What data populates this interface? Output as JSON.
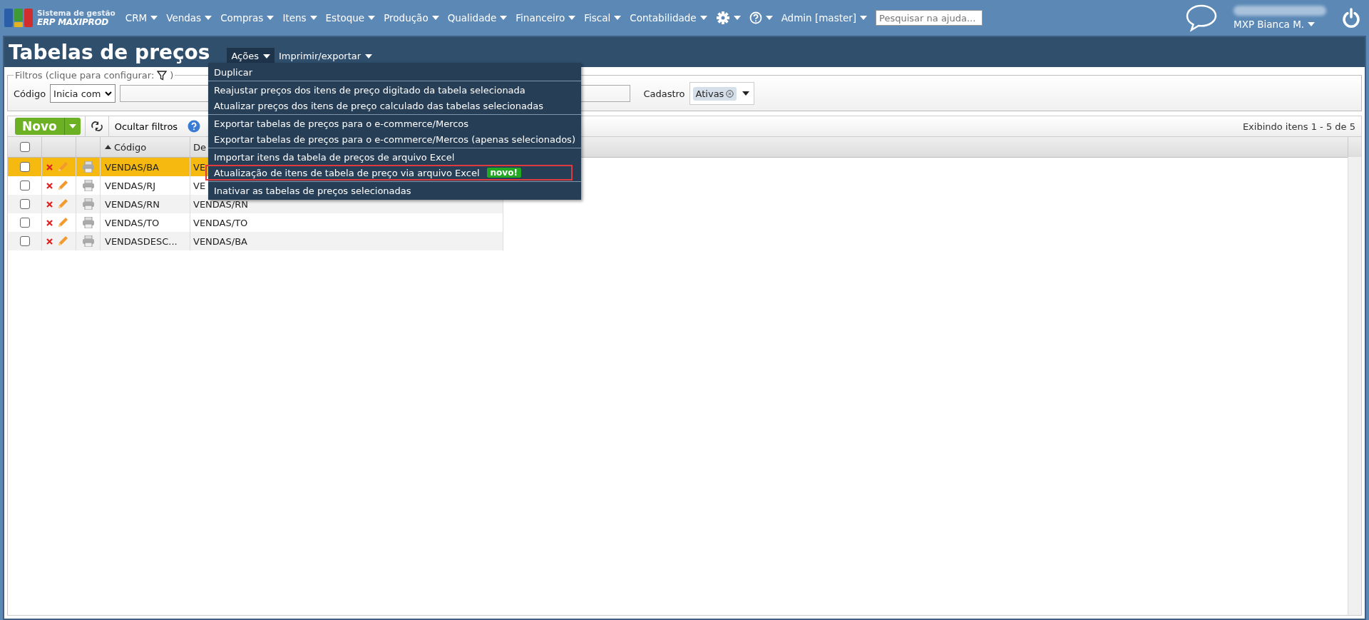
{
  "topbar": {
    "logo": {
      "line1": "Sistema de gestão",
      "line2": "ERP MAXIPROD"
    },
    "nav": [
      {
        "label": "CRM"
      },
      {
        "label": "Vendas"
      },
      {
        "label": "Compras"
      },
      {
        "label": "Itens"
      },
      {
        "label": "Estoque"
      },
      {
        "label": "Produção"
      },
      {
        "label": "Qualidade"
      },
      {
        "label": "Financeiro"
      },
      {
        "label": "Fiscal"
      },
      {
        "label": "Contabilidade"
      }
    ],
    "admin": "Admin [master]",
    "search": {
      "placeholder": "Pesquisar na ajuda..."
    },
    "user": "MXP Bianca M."
  },
  "page": {
    "title": "Tabelas de preços",
    "actions": [
      {
        "label": "Ações",
        "selected": true
      },
      {
        "label": "Imprimir/exportar",
        "selected": false
      }
    ]
  },
  "menu": {
    "groups": [
      [
        {
          "label": "Duplicar",
          "highlighted": false
        }
      ],
      [
        {
          "label": "Reajustar preços dos itens de preço digitado da tabela selecionada",
          "highlighted": false
        },
        {
          "label": "Atualizar preços dos itens de preço calculado das tabelas selecionadas",
          "highlighted": false
        }
      ],
      [
        {
          "label": "Exportar tabelas de preços para o e-commerce/Mercos",
          "highlighted": false
        },
        {
          "label": "Exportar tabelas de preços para o e-commerce/Mercos (apenas selecionados)",
          "highlighted": false
        }
      ],
      [
        {
          "label": "Importar itens da tabela de preços de arquivo Excel",
          "highlighted": false
        },
        {
          "label": "Atualização de itens de tabela de preço via arquivo Excel",
          "highlighted": true,
          "badge": "novo!"
        }
      ],
      [
        {
          "label": "Inativar as tabelas de preços selecionadas",
          "highlighted": false
        }
      ]
    ]
  },
  "filters": {
    "legend": "Filtros (clique para configurar:",
    "legend_end": ")",
    "code_label": "Código",
    "code_mode": "Inicia com",
    "cadastro_label": "Cadastro",
    "cadastro_tag": "Ativas"
  },
  "toolbar": {
    "new": "Novo",
    "hide_filters": "Ocultar filtros",
    "count": "Exibindo itens 1 - 5 de 5"
  },
  "table": {
    "columns": [
      "Código",
      "De"
    ],
    "select_all_checked": false,
    "rows": [
      {
        "code": "VENDAS/BA",
        "column_2": "VE",
        "selected": true,
        "checked": false
      },
      {
        "code": "VENDAS/RJ",
        "column_2": "VE",
        "selected": false,
        "checked": false
      },
      {
        "code": "VENDAS/RN",
        "column_2": "VENDAS/RN",
        "selected": false,
        "checked": false
      },
      {
        "code": "VENDAS/TO",
        "column_2": "VENDAS/TO",
        "selected": false,
        "checked": false
      },
      {
        "code": "VENDASDESC...",
        "column_2": "VENDAS/BA",
        "selected": false,
        "checked": false
      }
    ]
  }
}
